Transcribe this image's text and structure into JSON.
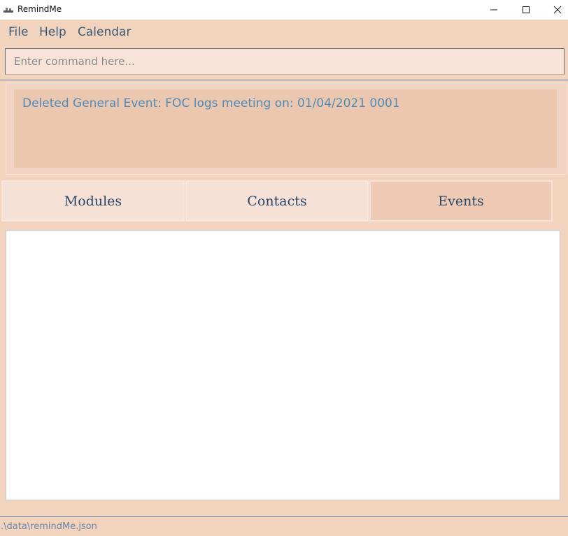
{
  "window": {
    "title": "RemindMe",
    "icon": "app-logo-icon",
    "controls": [
      "minimize-icon",
      "maximize-icon",
      "close-icon"
    ]
  },
  "menu": {
    "file": "File",
    "help": "Help",
    "calendar": "Calendar"
  },
  "command": {
    "placeholder": "Enter command here...",
    "value": ""
  },
  "result": {
    "message": "Deleted General Event: FOC logs meeting on: 01/04/2021 0001"
  },
  "tabs": [
    {
      "label": "Modules",
      "selected": false
    },
    {
      "label": "Contacts",
      "selected": false
    },
    {
      "label": "Events",
      "selected": true
    }
  ],
  "status": {
    "path": ".\\data\\remindMe.json"
  },
  "colors": {
    "background": "#f2d3be",
    "accent_text": "#4f8bb8",
    "tab_text": "#27476b",
    "divider": "#5e7ea6"
  }
}
